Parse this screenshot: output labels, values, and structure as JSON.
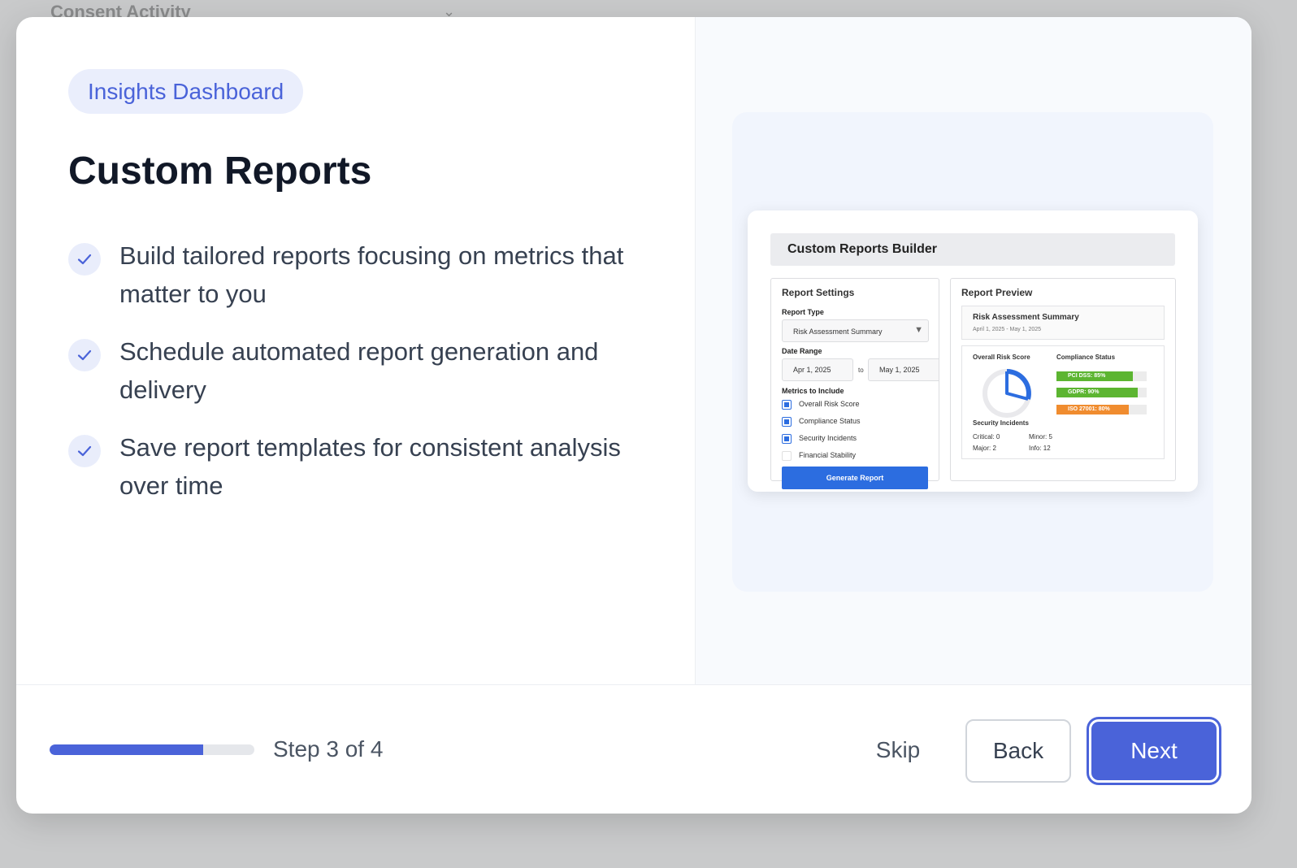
{
  "backdrop": {
    "title": "Consent Activity"
  },
  "modal": {
    "badge": "Insights Dashboard",
    "title": "Custom Reports",
    "features": [
      "Build tailored reports focusing on metrics that matter to you",
      "Schedule automated report generation and delivery",
      "Save report templates for consistent analysis over time"
    ]
  },
  "illustration": {
    "header": "Custom Reports Builder",
    "settings": {
      "title": "Report Settings",
      "report_type_label": "Report Type",
      "report_type_value": "Risk Assessment Summary",
      "date_range_label": "Date Range",
      "date_from": "Apr 1, 2025",
      "date_to_label": "to",
      "date_to": "May 1, 2025",
      "metrics_label": "Metrics to Include",
      "metrics": [
        {
          "label": "Overall Risk Score",
          "checked": true
        },
        {
          "label": "Compliance Status",
          "checked": true
        },
        {
          "label": "Security Incidents",
          "checked": true
        },
        {
          "label": "Financial Stability",
          "checked": false
        }
      ],
      "generate_button": "Generate Report"
    },
    "preview": {
      "title": "Report Preview",
      "summary_title": "Risk Assessment Summary",
      "summary_date": "April 1, 2025 - May 1, 2025",
      "risk_score_label": "Overall Risk Score",
      "compliance_label": "Compliance Status",
      "compliance": [
        {
          "label": "PCI DSS: 85%",
          "value": 85,
          "color": "#5cb531"
        },
        {
          "label": "GDPR: 90%",
          "value": 90,
          "color": "#5cb531"
        },
        {
          "label": "ISO 27001: 80%",
          "value": 80,
          "color": "#f08c2f"
        }
      ],
      "incidents_label": "Security Incidents",
      "incidents": [
        "Critical: 0",
        "Minor: 5",
        "Major: 2",
        "Info: 12"
      ]
    }
  },
  "footer": {
    "progress": 0.75,
    "step_text": "Step 3 of 4",
    "skip_label": "Skip",
    "back_label": "Back",
    "next_label": "Next"
  },
  "colors": {
    "accent": "#4a63d9",
    "title": "#111827",
    "body_text": "#374151"
  }
}
